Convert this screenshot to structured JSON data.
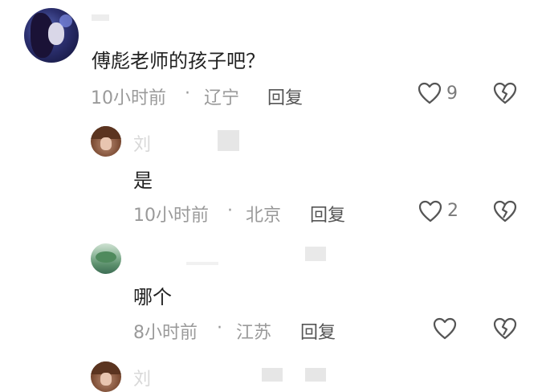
{
  "comment": {
    "text": "傅彪老师的孩子吧？",
    "time": "10小时前",
    "location": "辽宁",
    "reply_label": "回复",
    "like_count": "9"
  },
  "replies": [
    {
      "name_partial": "刘",
      "text": "是",
      "time": "10小时前",
      "location": "北京",
      "reply_label": "回复",
      "like_count": "2"
    },
    {
      "text": "哪个",
      "time": "8小时前",
      "location": "江苏",
      "reply_label": "回复",
      "like_count": ""
    },
    {
      "name_partial": "刘"
    }
  ],
  "separator": "·",
  "icons": {
    "like": "heart-outline-icon",
    "dislike": "broken-heart-icon"
  },
  "colors": {
    "text": "#222222",
    "meta": "#9a9a9a",
    "icon": "#555555"
  }
}
